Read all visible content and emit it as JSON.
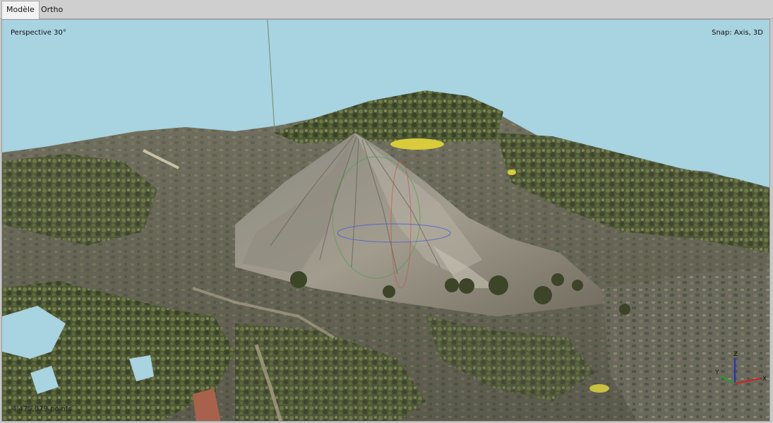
{
  "tabs": [
    {
      "label": "Modèle",
      "active": true
    },
    {
      "label": "Ortho",
      "active": false
    }
  ],
  "viewport": {
    "projection_label": "Perspective 30°",
    "snap_label": "Snap: Axis, 3D",
    "point_count_label": "4,475,079 points",
    "sky_color": "#a8d3e0"
  },
  "axis_gizmo": {
    "labels": {
      "z": "Z",
      "y": "Y",
      "x": "X"
    },
    "colors": {
      "x": "#d32020",
      "y": "#1fa02e",
      "z": "#2030d8"
    }
  },
  "icons": [
    "axis-gizmo-icon"
  ]
}
